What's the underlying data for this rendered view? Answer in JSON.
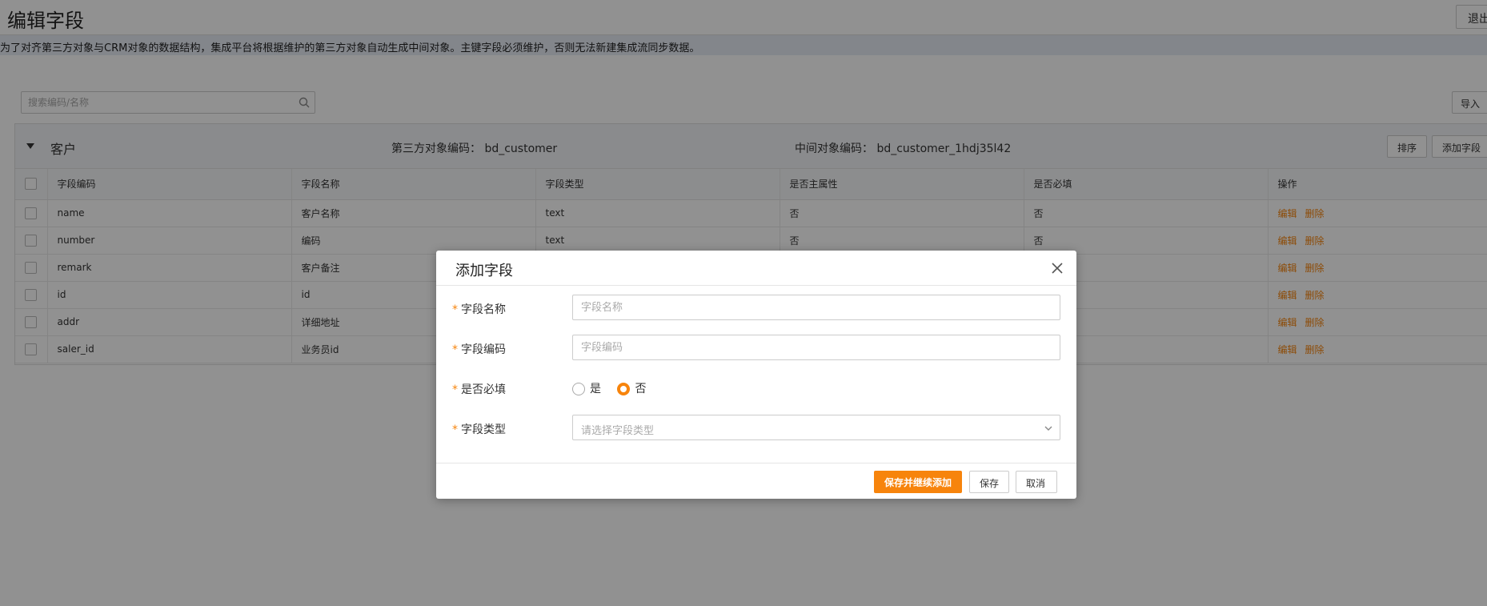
{
  "header": {
    "title": "编辑字段",
    "exit_label": "退出"
  },
  "notice": "为了对齐第三方对象与CRM对象的数据结构，集成平台将根据维护的第三方对象自动生成中间对象。主键字段必须维护，否则无法新建集成流同步数据。",
  "search": {
    "placeholder": "搜索编码/名称"
  },
  "import_label": "导入",
  "panel": {
    "name": "客户",
    "third_code": "第三方对象编码： bd_customer",
    "mid_code": "中间对象编码： bd_customer_1hdj35l42",
    "sort_label": "排序",
    "add_field_label": "添加字段"
  },
  "table": {
    "headers": [
      "字段编码",
      "字段名称",
      "字段类型",
      "是否主属性",
      "是否必填",
      "操作"
    ],
    "rows": [
      {
        "code": "name",
        "name": "客户名称",
        "type": "text",
        "primary": "否",
        "required": "否"
      },
      {
        "code": "number",
        "name": "编码",
        "type": "text",
        "primary": "否",
        "required": "否"
      },
      {
        "code": "remark",
        "name": "客户备注",
        "type": "",
        "primary": "",
        "required": ""
      },
      {
        "code": "id",
        "name": "id",
        "type": "",
        "primary": "",
        "required": ""
      },
      {
        "code": "addr",
        "name": "详细地址",
        "type": "",
        "primary": "",
        "required": ""
      },
      {
        "code": "saler_id",
        "name": "业务员id",
        "type": "",
        "primary": "",
        "required": ""
      }
    ],
    "edit_label": "编辑",
    "delete_label": "删除"
  },
  "modal": {
    "title": "添加字段",
    "required_mark": "*",
    "field_name_label": "字段名称",
    "field_name_placeholder": "字段名称",
    "field_code_label": "字段编码",
    "field_code_placeholder": "字段编码",
    "required_label": "是否必填",
    "required_yes": "是",
    "required_no": "否",
    "required_selected": "否",
    "field_type_label": "字段类型",
    "field_type_placeholder": "请选择字段类型",
    "save_continue_label": "保存并继续添加",
    "save_label": "保存",
    "cancel_label": "取消"
  },
  "colors": {
    "accent": "#f7840c",
    "overlay": "rgba(0,0,0,0.43)"
  }
}
